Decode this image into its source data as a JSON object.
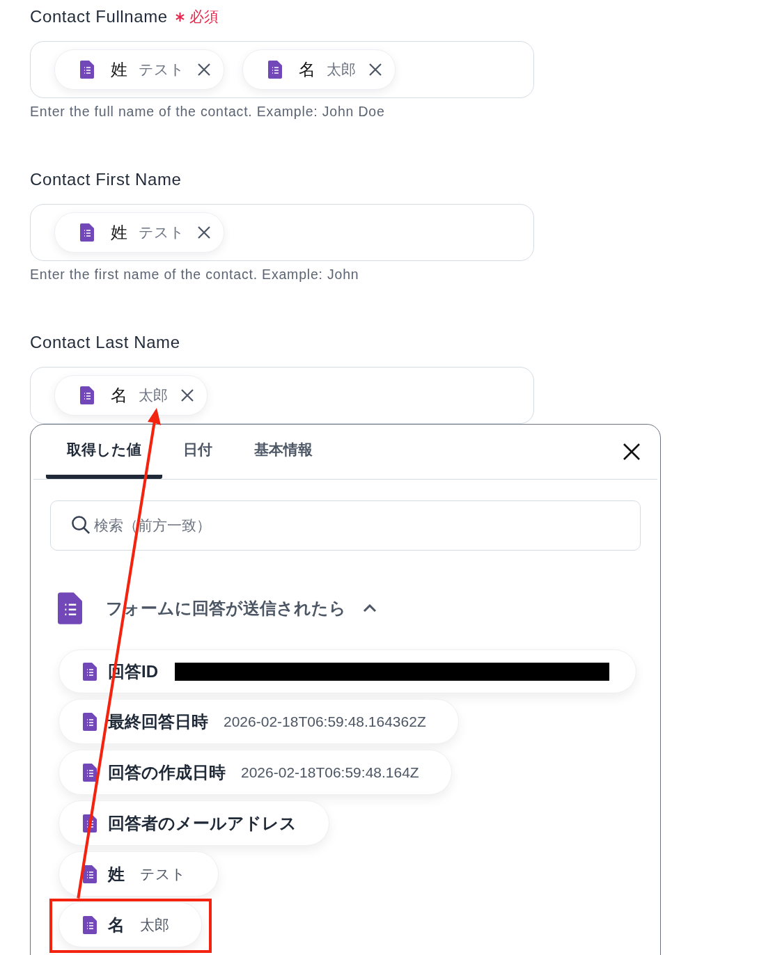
{
  "fields": [
    {
      "label": "Contact Fullname",
      "required": true,
      "required_text": "必須",
      "chips": [
        {
          "label": "姓",
          "value": "テスト"
        },
        {
          "label": "名",
          "value": "太郎"
        }
      ],
      "hint": "Enter the full name of the contact. Example: John Doe"
    },
    {
      "label": "Contact First Name",
      "chips": [
        {
          "label": "姓",
          "value": "テスト"
        }
      ],
      "hint": "Enter the first name of the contact. Example: John"
    },
    {
      "label": "Contact Last Name",
      "chips": [
        {
          "label": "名",
          "value": "太郎"
        }
      ]
    }
  ],
  "panel": {
    "tabs": [
      {
        "label": "取得した値",
        "selected": true
      },
      {
        "label": "日付",
        "selected": false
      },
      {
        "label": "基本情報",
        "selected": false
      }
    ],
    "search": {
      "placeholder": "検索（前方一致）"
    },
    "group": {
      "title": "フォームに回答が送信されたら",
      "expanded": true,
      "items": [
        {
          "kind": "redacted",
          "label": "回答ID",
          "highlighted": false
        },
        {
          "kind": "value",
          "label": "最終回答日時",
          "value": "2026-02-18T06:59:48.164362Z",
          "highlighted": false
        },
        {
          "kind": "value",
          "label": "回答の作成日時",
          "value": "2026-02-18T06:59:48.164Z",
          "highlighted": false
        },
        {
          "kind": "value",
          "label": "回答者のメールアドレス",
          "highlighted": false
        },
        {
          "kind": "value",
          "label": "姓",
          "value": "テスト",
          "highlighted": false
        },
        {
          "kind": "value",
          "label": "名",
          "value": "太郎",
          "highlighted": true
        }
      ]
    }
  }
}
